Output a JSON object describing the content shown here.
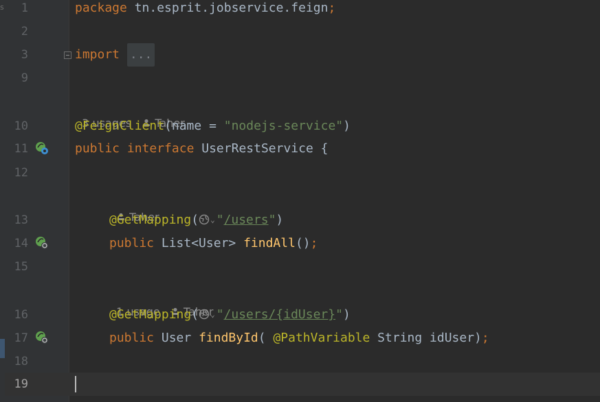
{
  "left_strip": {
    "label": "s"
  },
  "lines": {
    "l1": {
      "num": "1"
    },
    "l2": {
      "num": "2"
    },
    "l3": {
      "num": "3"
    },
    "l9": {
      "num": "9"
    },
    "l10": {
      "num": "10"
    },
    "l11": {
      "num": "11"
    },
    "l12": {
      "num": "12"
    },
    "l13": {
      "num": "13"
    },
    "l14": {
      "num": "14"
    },
    "l15": {
      "num": "15"
    },
    "l16": {
      "num": "16"
    },
    "l17": {
      "num": "17"
    },
    "l18": {
      "num": "18"
    },
    "l19": {
      "num": "19"
    }
  },
  "code": {
    "package_kw": "package",
    "package_name": " tn.esprit.jobservice.feign",
    "semicolon": ";",
    "import_kw": "import",
    "import_folded": "...",
    "feign_ann": "@FeignClient",
    "feign_open": "(name = ",
    "feign_value": "\"nodejs-service\"",
    "feign_close": ")",
    "public_kw": "public",
    "interface_kw": "interface",
    "interface_name": " UserRestService {",
    "getmapping_ann": "@GetMapping",
    "paren_open": "(",
    "quote": "\"",
    "url1": "/users",
    "paren_close": ")",
    "findall_ret": " List<User> ",
    "findall_name": "findAll",
    "findall_args": "()",
    "url2": "/users/{idUser}",
    "findbyid_ret": " User ",
    "findbyid_name": "findById",
    "findbyid_open": "( ",
    "pathvar_ann": "@PathVariable",
    "findbyid_param": " String idUser)"
  },
  "hints": {
    "class_usages": "3 usages",
    "class_author": "Taher",
    "findall_author": "Taher",
    "findbyid_usages": "1 usage",
    "findbyid_author": "Taher"
  },
  "colors": {
    "background": "#2b2b2b",
    "keyword": "#cc7832",
    "annotation": "#bbb529",
    "string": "#6a8759",
    "method": "#ffc66d",
    "text": "#a9b7c6"
  },
  "icons": {
    "gutter": "spring-bean-icon",
    "fold": "fold-expand-icon",
    "globe": "web-endpoint-icon",
    "user": "user-icon"
  }
}
